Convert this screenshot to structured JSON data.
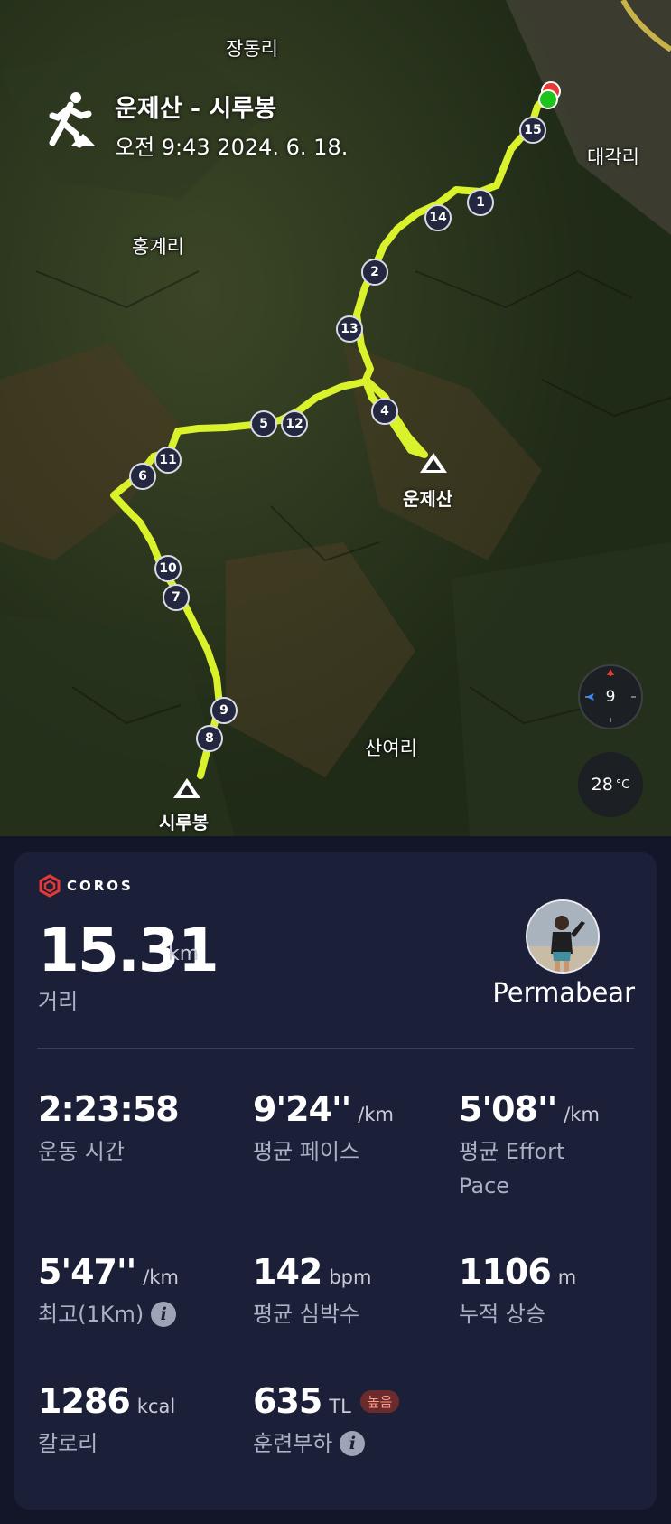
{
  "map": {
    "places": [
      "장동리",
      "대각리",
      "홍계리",
      "산여리"
    ],
    "peaks": [
      "운제산",
      "시루봉"
    ],
    "km_markers": [
      "1",
      "2",
      "4",
      "5",
      "6",
      "7",
      "8",
      "9",
      "10",
      "11",
      "12",
      "13",
      "14",
      "15"
    ],
    "title": "운제산 - 시루봉",
    "subtitle": "오전 9:43 2024. 6. 18.",
    "compass_value": "9",
    "temperature_value": "28",
    "temperature_unit": "°C",
    "track_color": "#d9f22b",
    "activity_icon": "hiking-person-icon"
  },
  "card": {
    "brand": "COROS",
    "distance": {
      "value": "15.31",
      "unit": "km",
      "label": "거리"
    },
    "username": "Permabear",
    "stats": [
      {
        "value": "2:23:58",
        "unit": "",
        "label": "운동 시간"
      },
      {
        "value": "9'24''",
        "unit": "/km",
        "label": "평균 페이스"
      },
      {
        "value": "5'08''",
        "unit": "/km",
        "label": "평균 Effort Pace"
      },
      {
        "value": "5'47''",
        "unit": "/km",
        "label": "최고(1Km)"
      },
      {
        "value": "142",
        "unit": "bpm",
        "label": "평균 심박수"
      },
      {
        "value": "1106",
        "unit": "m",
        "label": "누적 상승"
      },
      {
        "value": "1286",
        "unit": "kcal",
        "label": "칼로리"
      },
      {
        "value": "635",
        "unit": "TL",
        "label": "훈련부하",
        "badge": "높음"
      }
    ]
  }
}
